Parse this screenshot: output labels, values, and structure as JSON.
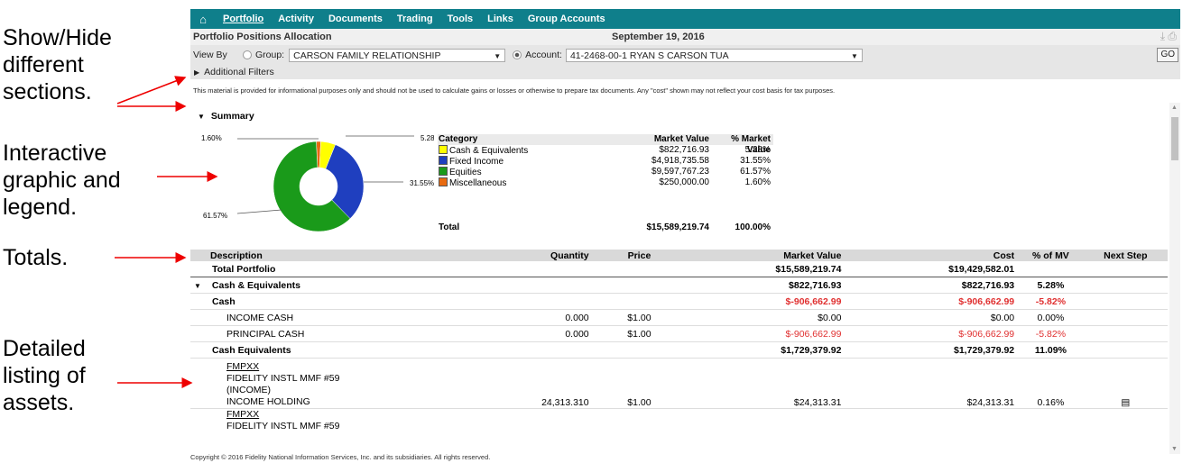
{
  "annotations": {
    "show_hide": [
      "Show/Hide",
      "different",
      "sections."
    ],
    "interactive": [
      "Interactive",
      "graphic and",
      "legend."
    ],
    "totals": [
      "Totals."
    ],
    "detailed": [
      "Detailed",
      "listing of",
      "assets."
    ]
  },
  "nav": {
    "home_icon": "home-icon",
    "tabs": [
      "Portfolio",
      "Activity",
      "Documents",
      "Trading",
      "Tools",
      "Links",
      "Group Accounts"
    ]
  },
  "header": {
    "title": "Portfolio Positions Allocation",
    "date": "September 19, 2016"
  },
  "viewby": {
    "label": "View By",
    "group_label": "Group:",
    "group_value": "CARSON FAMILY RELATIONSHIP",
    "account_label": "Account:",
    "account_value": "41-2468-00-1 RYAN S CARSON TUA",
    "go": "GO"
  },
  "filters": {
    "label": "Additional Filters"
  },
  "disclaimer": "This material is provided for informational purposes only and should not be used to calculate gains or losses or otherwise to prepare tax documents. Any \"cost\" shown may not reflect your cost basis for tax purposes.",
  "summary": {
    "label": "Summary"
  },
  "chart_data": {
    "type": "pie",
    "categories": [
      "Cash & Equivalents",
      "Fixed Income",
      "Equities",
      "Miscellaneous"
    ],
    "values": [
      5.28,
      31.55,
      61.57,
      1.6
    ],
    "colors": [
      "#ffff00",
      "#1f3fbf",
      "#1a9a1a",
      "#e86a10"
    ],
    "labels": [
      "5.28%",
      "31.55%",
      "61.57%",
      "1.60%"
    ],
    "donut": true
  },
  "legend": {
    "headers": [
      "Category",
      "Market Value",
      "% Market Value"
    ],
    "rows": [
      {
        "name": "Cash & Equivalents",
        "mv": "$822,716.93",
        "pct": "5.28%"
      },
      {
        "name": "Fixed Income",
        "mv": "$4,918,735.58",
        "pct": "31.55%"
      },
      {
        "name": "Equities",
        "mv": "$9,597,767.23",
        "pct": "61.57%"
      },
      {
        "name": "Miscellaneous",
        "mv": "$250,000.00",
        "pct": "1.60%"
      }
    ],
    "total": {
      "name": "Total",
      "mv": "$15,589,219.74",
      "pct": "100.00%"
    }
  },
  "table": {
    "headers": [
      "Description",
      "Quantity",
      "Price",
      "Market Value",
      "Cost",
      "% of MV",
      "Next Step"
    ],
    "total_portfolio": {
      "desc": "Total Portfolio",
      "mv": "$15,589,219.74",
      "cost": "$19,429,582.01"
    },
    "cash_eq": {
      "desc": "Cash & Equivalents",
      "mv": "$822,716.93",
      "cost": "$822,716.93",
      "pct": "5.28%"
    },
    "cash": {
      "desc": "Cash",
      "mv": "$-906,662.99",
      "cost": "$-906,662.99",
      "pct": "-5.82%"
    },
    "income_cash": {
      "desc": "INCOME CASH",
      "qty": "0.000",
      "price": "$1.00",
      "mv": "$0.00",
      "cost": "$0.00",
      "pct": "0.00%"
    },
    "principal_cash": {
      "desc": "PRINCIPAL CASH",
      "qty": "0.000",
      "price": "$1.00",
      "mv": "$-906,662.99",
      "cost": "$-906,662.99",
      "pct": "-5.82%"
    },
    "cash_equivalents": {
      "desc": "Cash Equivalents",
      "mv": "$1,729,379.92",
      "cost": "$1,729,379.92",
      "pct": "11.09%"
    },
    "fmpxx1": {
      "ticker": "FMPXX",
      "name": "FIDELITY INSTL MMF #59",
      "sub": "(INCOME)",
      "desc": "INCOME HOLDING",
      "qty": "24,313.310",
      "price": "$1.00",
      "mv": "$24,313.31",
      "cost": "$24,313.31",
      "pct": "0.16%"
    },
    "fmpxx2": {
      "ticker": "FMPXX",
      "name": "FIDELITY INSTL MMF #59"
    }
  },
  "footer": "Copyright © 2016 Fidelity National Information Services, Inc. and its subsidiaries. All rights reserved."
}
